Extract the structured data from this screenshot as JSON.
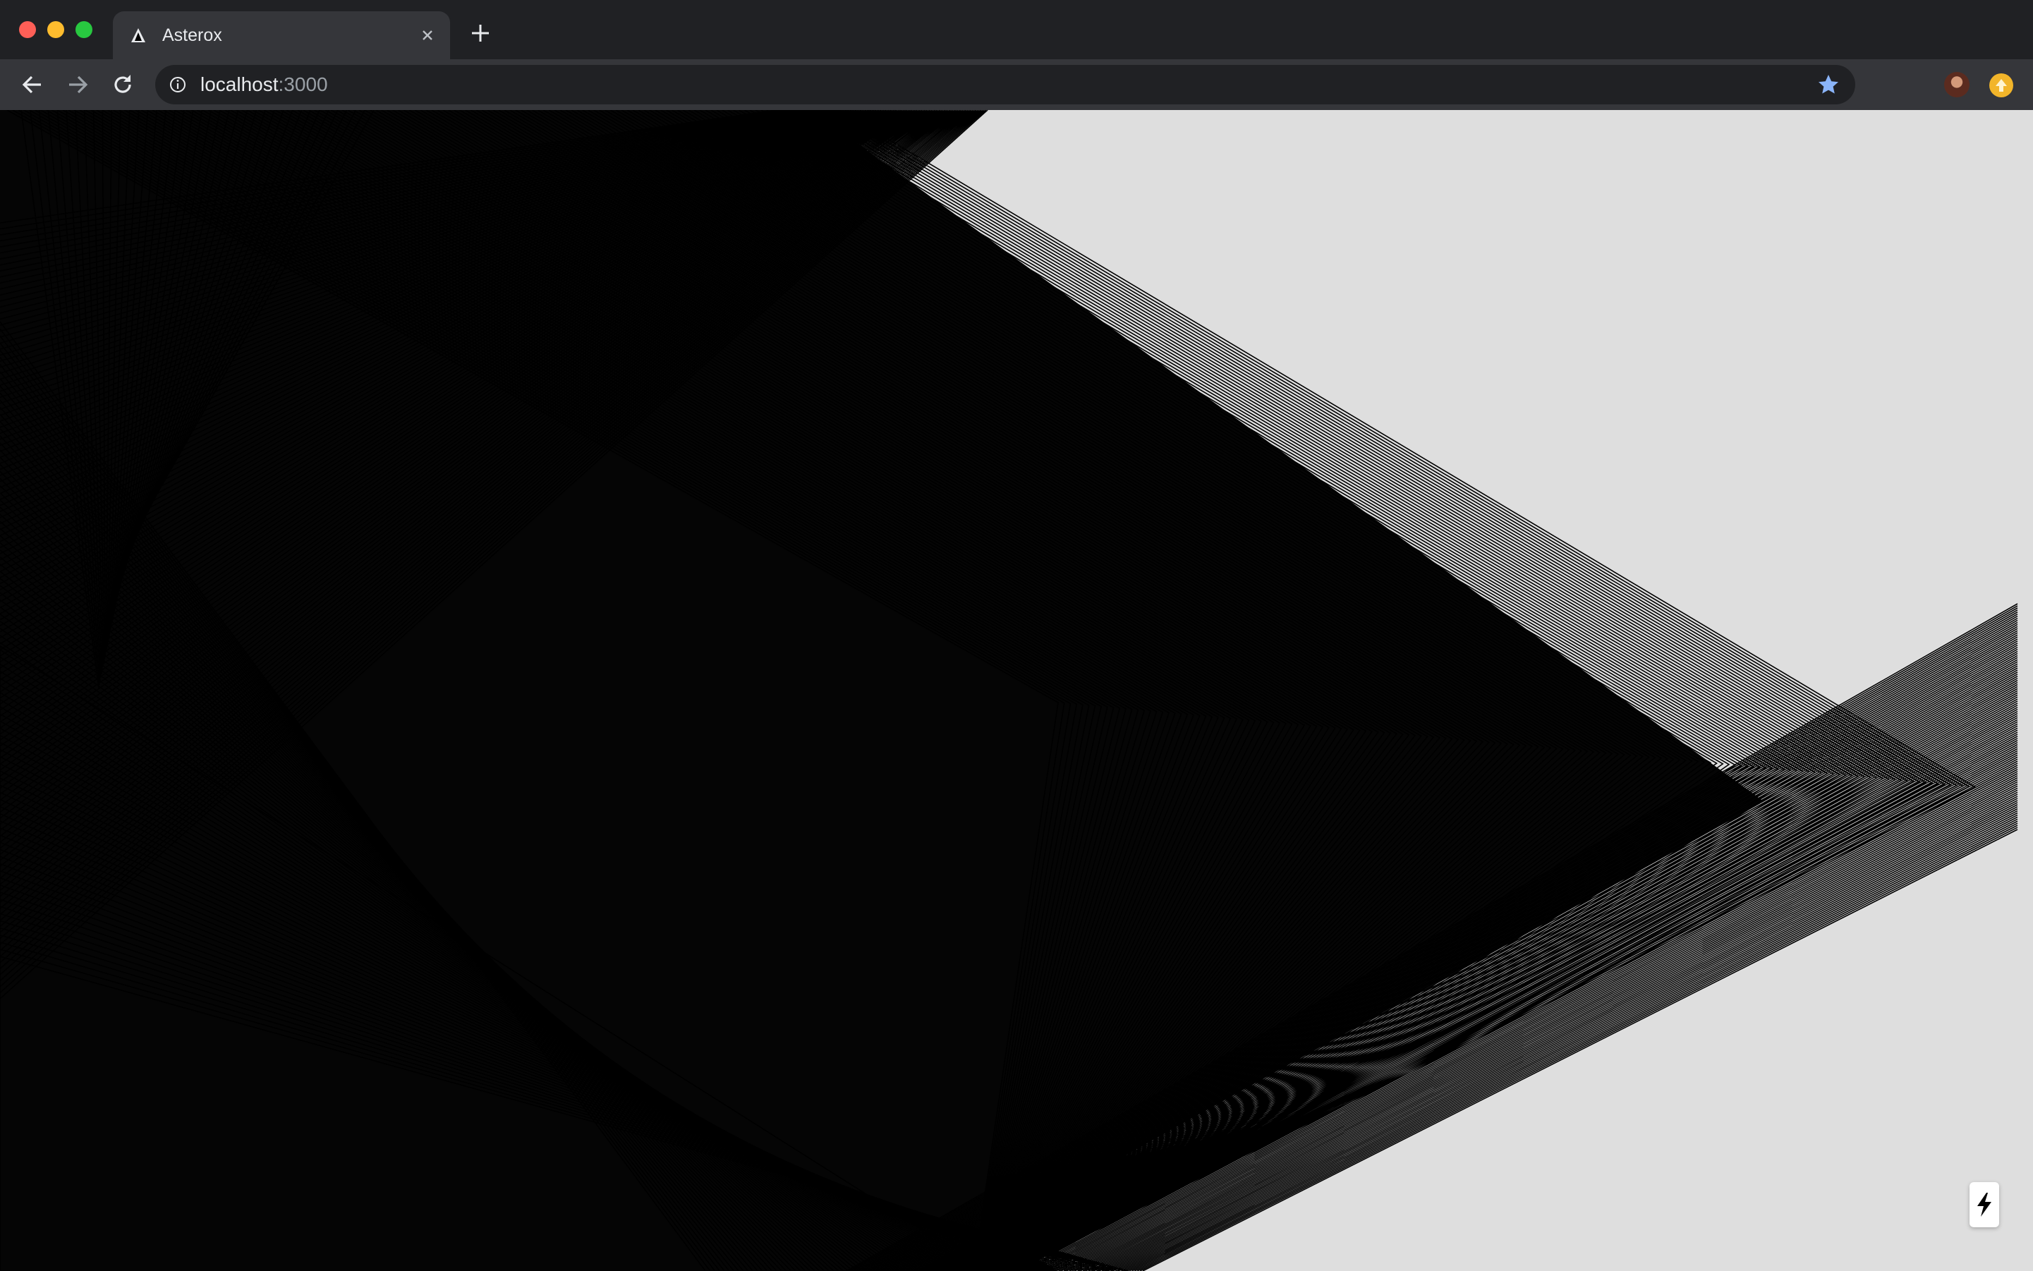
{
  "browser": {
    "tab": {
      "title": "Asterox",
      "favicon": "triangle-logo-icon",
      "close_icon": "close-icon"
    },
    "new_tab_icon": "plus-icon",
    "toolbar": {
      "back_icon": "arrow-left-icon",
      "forward_icon": "arrow-right-icon",
      "reload_icon": "reload-icon",
      "info_icon": "info-icon",
      "url_host": "localhost",
      "url_port": ":3000",
      "bookmark_icon": "star-icon",
      "profile_icon": "avatar",
      "extension_icon": "extension-icon"
    }
  },
  "page": {
    "background_color": "#dedede",
    "line_color": "#000000",
    "badge_icon": "lightning-icon"
  },
  "colors": {
    "titlebar": "#202124",
    "toolbar": "#35363a",
    "omnibox": "#202124",
    "star": "#8ab4f8",
    "extension": "#f2b52a"
  }
}
